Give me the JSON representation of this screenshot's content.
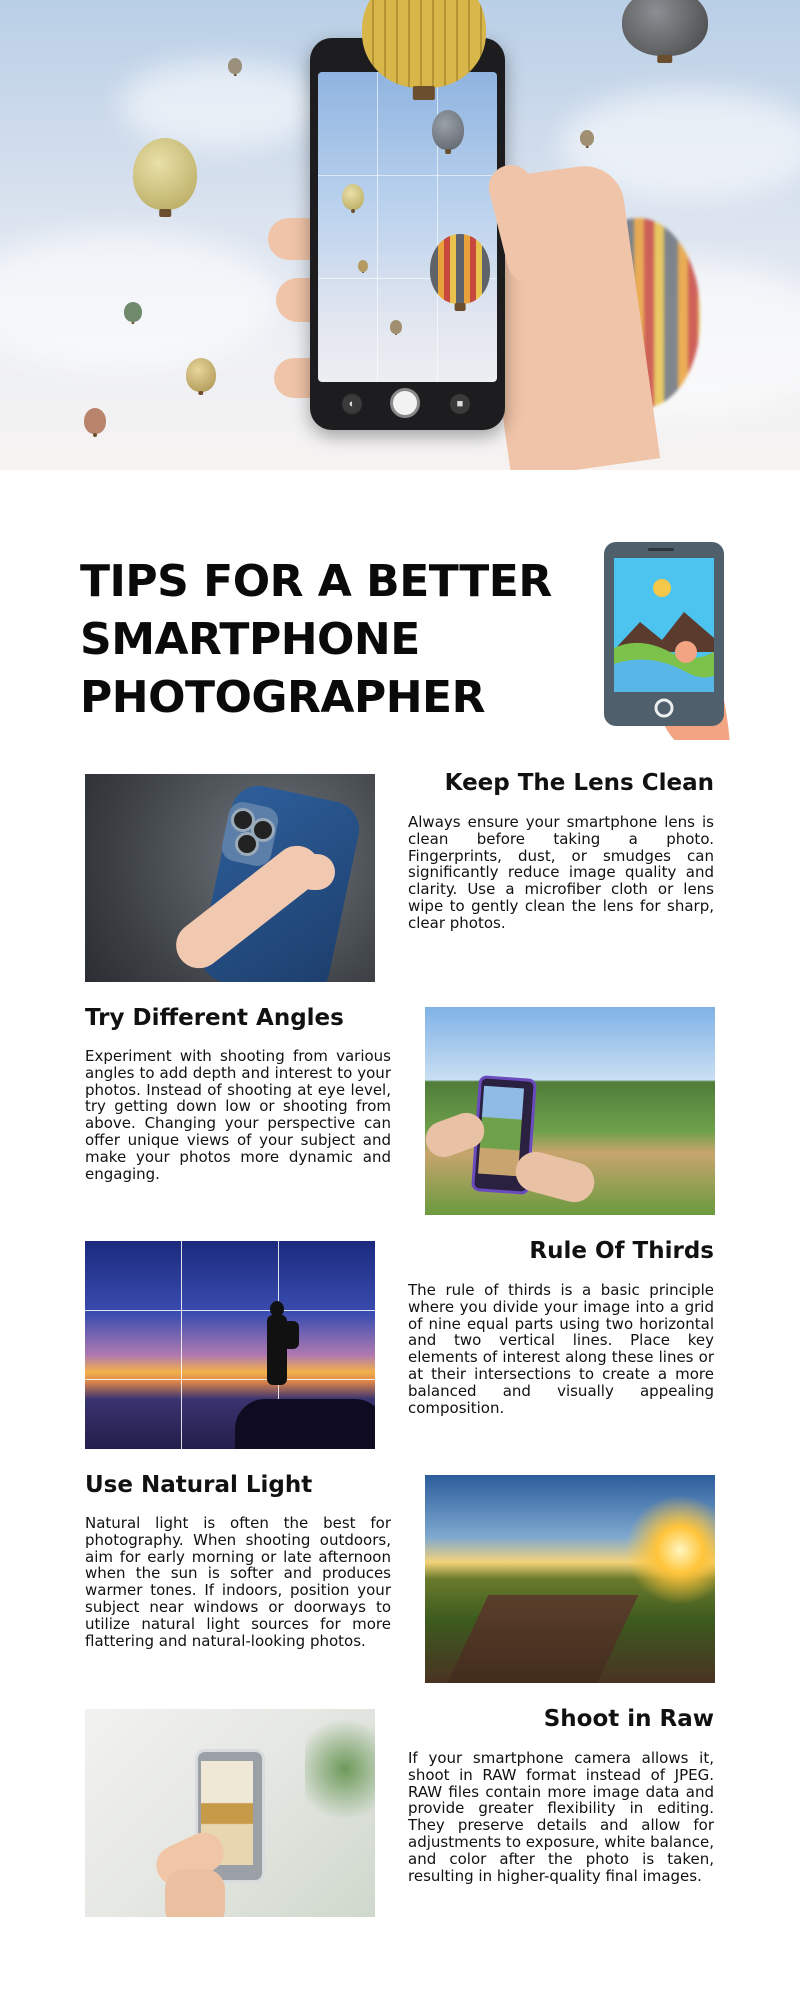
{
  "header": {
    "title_lines": [
      "TIPS FOR A BETTER",
      "SMARTPHONE",
      "PHOTOGRAPHER"
    ]
  },
  "hero": {
    "image": "hand-holding-phone-photographing-hot-air-balloons"
  },
  "sections": [
    {
      "title": "Keep The Lens Clean",
      "text": "Always ensure your smartphone lens is clean before taking a photo. Fingerprints, dust, or smudges can significantly reduce image quality and clarity. Use a microfiber cloth or lens wipe to gently clean the lens for sharp, clear photos.",
      "image": "hand-holding-blue-phone-rear-camera"
    },
    {
      "title": "Try Different Angles",
      "text": "Experiment with shooting from various angles to add depth and interest to your photos. Instead of shooting at eye level, try getting down low or shooting from above. Changing your perspective can offer unique views of your subject and make your photos more dynamic and engaging.",
      "image": "hands-photographing-green-fields"
    },
    {
      "title": "Rule Of Thirds",
      "text": "The rule of thirds is a basic principle where you divide your image into a grid of nine equal parts using two horizontal and two vertical lines. Place key elements of interest along these lines or at their intersections to create a more balanced and visually appealing composition.",
      "image": "silhouette-at-sunset-with-thirds-grid"
    },
    {
      "title": "Use Natural Light",
      "text": "Natural light is often the best for photography. When shooting outdoors, aim for early morning or late afternoon when the sun is softer and produces warmer tones. If indoors, position your subject near windows or doorways to utilize natural light sources for more flattering and natural-looking photos.",
      "image": "vineyard-at-sunset"
    },
    {
      "title": "Shoot in Raw",
      "text": "If your smartphone camera allows it, shoot in RAW format instead of JPEG. RAW files contain more image data and provide greater flexibility in editing. They preserve details and allow for adjustments to exposure, white balance, and color after the photo is taken, resulting in higher-quality final images.",
      "image": "phone-photographing-food-indoors"
    }
  ],
  "colors": {
    "text": "#111111",
    "background": "#ffffff",
    "deco_phone": "#4f5f6b",
    "deco_screen": "#4dc3ef",
    "deco_hand": "#f2a483"
  }
}
